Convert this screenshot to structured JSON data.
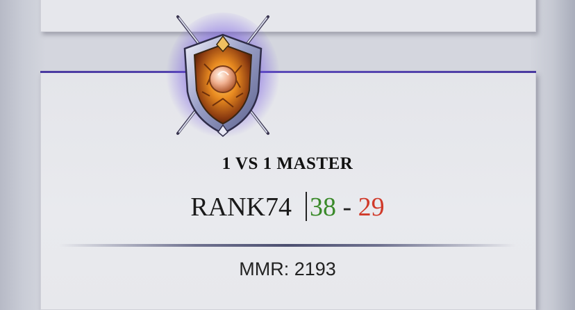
{
  "profile": {
    "mode_title": "1 VS 1 MASTER",
    "rank_label": "RANK74",
    "wins": "38",
    "separator": "-",
    "losses": "29",
    "mmr_text": "MMR: 2193"
  },
  "badge": {
    "icon": "master-shield-crossed-swords-icon"
  },
  "colors": {
    "accent": "#5a4ab5",
    "wins": "#3a8a2a",
    "losses": "#d03a2a"
  }
}
